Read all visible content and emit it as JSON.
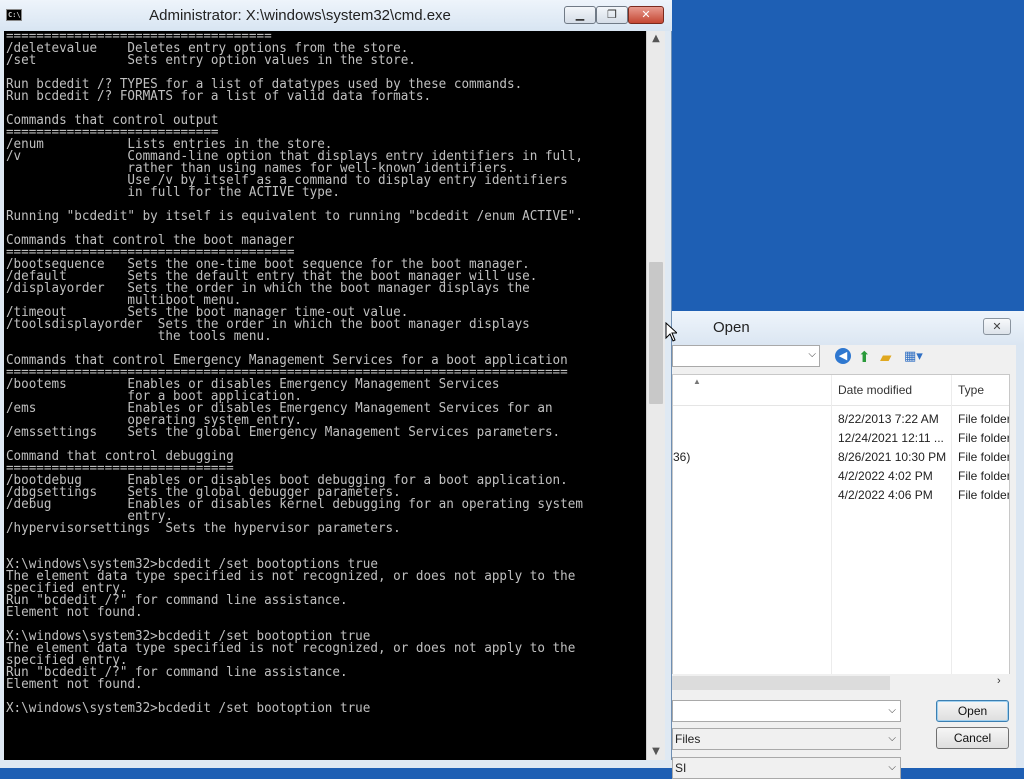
{
  "cmd": {
    "title": "Administrator: X:\\windows\\system32\\cmd.exe",
    "icon": "C:\\",
    "buttons": {
      "minimize": "▁",
      "maximize": "❐",
      "close": "✕"
    },
    "lines": [
      "===================================",
      "/deletevalue    Deletes entry options from the store.",
      "/set            Sets entry option values in the store.",
      "",
      "Run bcdedit /? TYPES for a list of datatypes used by these commands.",
      "Run bcdedit /? FORMATS for a list of valid data formats.",
      "",
      "Commands that control output",
      "============================",
      "/enum           Lists entries in the store.",
      "/v              Command-line option that displays entry identifiers in full,",
      "                rather than using names for well-known identifiers.",
      "                Use /v by itself as a command to display entry identifiers",
      "                in full for the ACTIVE type.",
      "",
      "Running \"bcdedit\" by itself is equivalent to running \"bcdedit /enum ACTIVE\".",
      "",
      "Commands that control the boot manager",
      "======================================",
      "/bootsequence   Sets the one-time boot sequence for the boot manager.",
      "/default        Sets the default entry that the boot manager will use.",
      "/displayorder   Sets the order in which the boot manager displays the",
      "                multiboot menu.",
      "/timeout        Sets the boot manager time-out value.",
      "/toolsdisplayorder  Sets the order in which the boot manager displays",
      "                    the tools menu.",
      "",
      "Commands that control Emergency Management Services for a boot application",
      "==========================================================================",
      "/bootems        Enables or disables Emergency Management Services",
      "                for a boot application.",
      "/ems            Enables or disables Emergency Management Services for an",
      "                operating system entry.",
      "/emssettings    Sets the global Emergency Management Services parameters.",
      "",
      "Command that control debugging",
      "==============================",
      "/bootdebug      Enables or disables boot debugging for a boot application.",
      "/dbgsettings    Sets the global debugger parameters.",
      "/debug          Enables or disables kernel debugging for an operating system",
      "                entry.",
      "/hypervisorsettings  Sets the hypervisor parameters.",
      "",
      "",
      "X:\\windows\\system32>bcdedit /set bootoptions true",
      "The element data type specified is not recognized, or does not apply to the",
      "specified entry.",
      "Run \"bcdedit /?\" for command line assistance.",
      "Element not found.",
      "",
      "X:\\windows\\system32>bcdedit /set bootoption true",
      "The element data type specified is not recognized, or does not apply to the",
      "specified entry.",
      "Run \"bcdedit /?\" for command line assistance.",
      "Element not found.",
      "",
      "X:\\windows\\system32>bcdedit /set bootoption true"
    ]
  },
  "dialog": {
    "title": "Open",
    "close": "✕",
    "columns": {
      "date": "Date modified",
      "type": "Type"
    },
    "rows": [
      {
        "name": "",
        "date": "8/22/2013 7:22 AM",
        "type": "File folder"
      },
      {
        "name": "",
        "date": "12/24/2021 12:11 ...",
        "type": "File folder"
      },
      {
        "name": "36)",
        "date": "8/26/2021 10:30 PM",
        "type": "File folder"
      },
      {
        "name": "",
        "date": "4/2/2022 4:02 PM",
        "type": "File folder"
      },
      {
        "name": "",
        "date": "4/2/2022 4:06 PM",
        "type": "File folder"
      }
    ],
    "file_type": "Files",
    "encoding": "SI",
    "open_label": "Open",
    "cancel_label": "Cancel"
  }
}
